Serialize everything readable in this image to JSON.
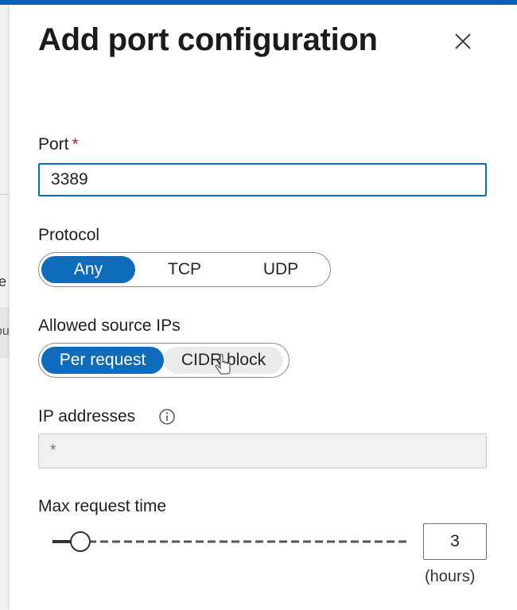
{
  "background": {
    "fragment_1": "e",
    "fragment_2": "ou"
  },
  "panel": {
    "title": "Add port configuration",
    "close_icon": "close-icon"
  },
  "port": {
    "label": "Port",
    "required_marker": "*",
    "value": "3389"
  },
  "protocol": {
    "label": "Protocol",
    "options": [
      "Any",
      "TCP",
      "UDP"
    ],
    "selected": "Any"
  },
  "source_ips": {
    "label": "Allowed source IPs",
    "options": [
      "Per request",
      "CIDR block"
    ],
    "selected": "Per request",
    "hovered": "CIDR block"
  },
  "ip_addresses": {
    "label": "IP addresses",
    "info_icon": "info-icon",
    "placeholder": "*"
  },
  "max_request_time": {
    "label": "Max request time",
    "value": "3",
    "unit": "(hours)",
    "slider_level": 0.05
  },
  "colors": {
    "accent": "#0f6cbd",
    "required": "#a4262c",
    "disabled_field": "#f0f0f0"
  }
}
